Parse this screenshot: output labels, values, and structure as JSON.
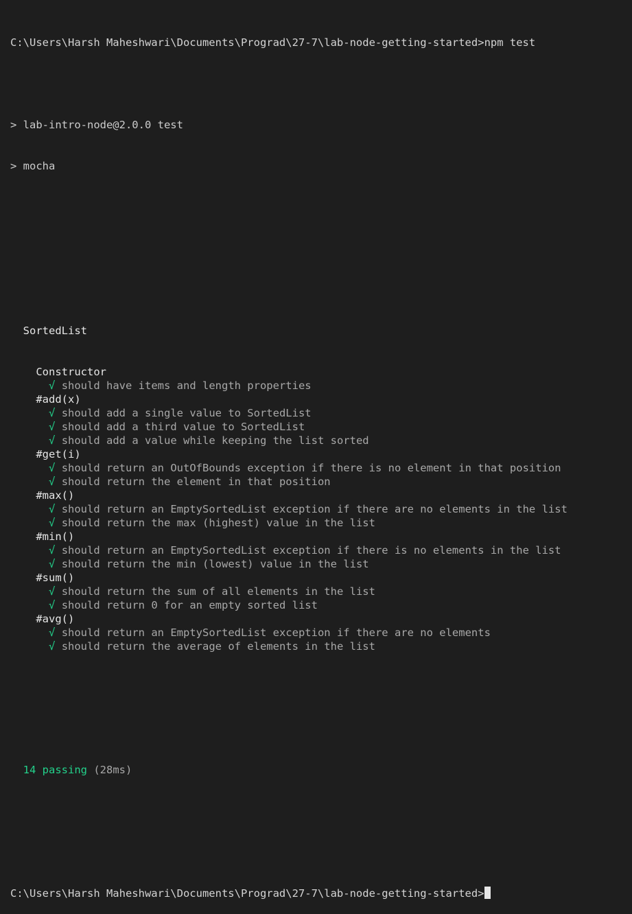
{
  "command_line": {
    "prompt": "C:\\Users\\Harsh Maheshwari\\Documents\\Prograd\\27-7\\lab-node-getting-started>",
    "command": "npm test"
  },
  "script_echo": [
    "> lab-intro-node@2.0.0 test",
    "> mocha"
  ],
  "root_suite": "SortedList",
  "check_glyph": "√",
  "suites": [
    {
      "name": "Constructor",
      "tests": [
        "should have items and length properties"
      ]
    },
    {
      "name": "#add(x)",
      "tests": [
        "should add a single value to SortedList",
        "should add a third value to SortedList",
        "should add a value while keeping the list sorted"
      ]
    },
    {
      "name": "#get(i)",
      "tests": [
        "should return an OutOfBounds exception if there is no element in that position",
        "should return the element in that position"
      ]
    },
    {
      "name": "#max()",
      "tests": [
        "should return an EmptySortedList exception if there are no elements in the list",
        "should return the max (highest) value in the list"
      ]
    },
    {
      "name": "#min()",
      "tests": [
        "should return an EmptySortedList exception if there is no elements in the list",
        "should return the min (lowest) value in the list"
      ]
    },
    {
      "name": "#sum()",
      "tests": [
        "should return the sum of all elements in the list",
        "should return 0 for an empty sorted list"
      ]
    },
    {
      "name": "#avg()",
      "tests": [
        "should return an EmptySortedList exception if there are no elements",
        "should return the average of elements in the list"
      ]
    }
  ],
  "summary": {
    "passing": "14 passing",
    "duration": "(28ms)"
  },
  "final_prompt": "C:\\Users\\Harsh Maheshwari\\Documents\\Prograd\\27-7\\lab-node-getting-started>",
  "colors": {
    "background": "#1e1e1e",
    "pass": "#23d18b",
    "text": "#cccccc"
  }
}
